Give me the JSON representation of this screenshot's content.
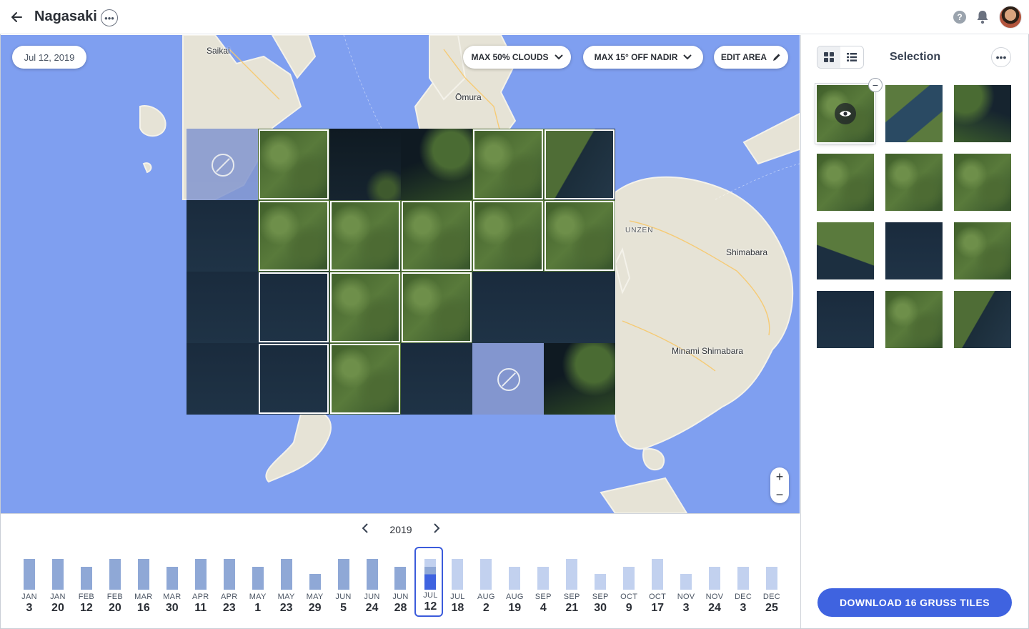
{
  "header": {
    "title": "Nagasaki",
    "back_icon": "arrow-left-icon",
    "more_icon": "more-horizontal-icon",
    "help_label": "?",
    "notification_icon": "bell-icon",
    "avatar_icon": "user-avatar"
  },
  "map": {
    "date_filter": "Jul 12, 2019",
    "clouds_filter": "MAX 50% CLOUDS",
    "nadir_filter": "MAX 15° OFF NADIR",
    "edit_area": "EDIT AREA",
    "places": {
      "saikai": "Saikai",
      "omura": "Ōmura",
      "unzen": "UNZEN",
      "shimabara": "Shimabara",
      "minami_shimabara": "Minami Shimabara"
    },
    "zoom_in": "+",
    "zoom_out": "−",
    "colors": {
      "water": "#7f9ff0",
      "land": "#e6e3d6",
      "accent": "#3f63e0"
    }
  },
  "tiles": {
    "rows": [
      [
        "blocked",
        "selected-forest",
        "dark",
        "dark-forest",
        "selected-forest",
        "selected-coast"
      ],
      [
        "water",
        "selected-forest",
        "selected-forest",
        "selected-forest",
        "selected-forest",
        "selected-forest"
      ],
      [
        "water",
        "selected-water",
        "selected-forest",
        "selected-forest",
        "water",
        "water"
      ],
      [
        "water",
        "selected-water",
        "selected-forest",
        "water",
        "blocked",
        "dark-forest"
      ]
    ]
  },
  "timeline": {
    "year": "2019",
    "prev_icon": "chevron-left-icon",
    "next_icon": "chevron-right-icon",
    "active_index": 14,
    "bars": [
      {
        "month": "JAN",
        "day": "3",
        "level": 0.9,
        "tone": "mid"
      },
      {
        "month": "JAN",
        "day": "20",
        "level": 0.9,
        "tone": "mid"
      },
      {
        "month": "FEB",
        "day": "12",
        "level": 0.67,
        "tone": "mid"
      },
      {
        "month": "FEB",
        "day": "20",
        "level": 0.9,
        "tone": "mid"
      },
      {
        "month": "MAR",
        "day": "16",
        "level": 0.9,
        "tone": "mid"
      },
      {
        "month": "MAR",
        "day": "30",
        "level": 0.67,
        "tone": "mid"
      },
      {
        "month": "APR",
        "day": "11",
        "level": 0.9,
        "tone": "mid"
      },
      {
        "month": "APR",
        "day": "23",
        "level": 0.9,
        "tone": "mid"
      },
      {
        "month": "MAY",
        "day": "1",
        "level": 0.67,
        "tone": "mid"
      },
      {
        "month": "MAY",
        "day": "23",
        "level": 0.9,
        "tone": "mid"
      },
      {
        "month": "MAY",
        "day": "29",
        "level": 0.45,
        "tone": "mid"
      },
      {
        "month": "JUN",
        "day": "5",
        "level": 0.9,
        "tone": "mid"
      },
      {
        "month": "JUN",
        "day": "24",
        "level": 0.9,
        "tone": "mid"
      },
      {
        "month": "JUN",
        "day": "28",
        "level": 0.67,
        "tone": "mid"
      },
      {
        "month": "JUL",
        "day": "12",
        "level": 0.9,
        "tone": "active"
      },
      {
        "month": "JUL",
        "day": "18",
        "level": 0.9,
        "tone": "light"
      },
      {
        "month": "AUG",
        "day": "2",
        "level": 0.9,
        "tone": "light"
      },
      {
        "month": "AUG",
        "day": "19",
        "level": 0.67,
        "tone": "light"
      },
      {
        "month": "SEP",
        "day": "4",
        "level": 0.67,
        "tone": "light"
      },
      {
        "month": "SEP",
        "day": "21",
        "level": 0.9,
        "tone": "light"
      },
      {
        "month": "SEP",
        "day": "30",
        "level": 0.45,
        "tone": "light"
      },
      {
        "month": "OCT",
        "day": "9",
        "level": 0.67,
        "tone": "light"
      },
      {
        "month": "OCT",
        "day": "17",
        "level": 0.9,
        "tone": "light"
      },
      {
        "month": "NOV",
        "day": "3",
        "level": 0.45,
        "tone": "light"
      },
      {
        "month": "NOV",
        "day": "24",
        "level": 0.67,
        "tone": "light"
      },
      {
        "month": "DEC",
        "day": "3",
        "level": 0.67,
        "tone": "light"
      },
      {
        "month": "DEC",
        "day": "25",
        "level": 0.67,
        "tone": "light"
      }
    ],
    "colors": {
      "mid": "#8fa8d6",
      "light": "#c2d1ef",
      "active": "#3f63e0",
      "active_light": "#9fb3e3"
    }
  },
  "sidebar": {
    "title": "Selection",
    "grid_icon": "grid-view-icon",
    "list_icon": "list-view-icon",
    "more_icon": "more-horizontal-icon",
    "remove_label": "−",
    "thumbs": [
      "forest",
      "harbor",
      "coast-dark",
      "forest",
      "forest",
      "forest",
      "forest-water",
      "water",
      "forest",
      "water",
      "forest",
      "coast"
    ],
    "download": "DOWNLOAD 16 GRUSS TILES"
  }
}
